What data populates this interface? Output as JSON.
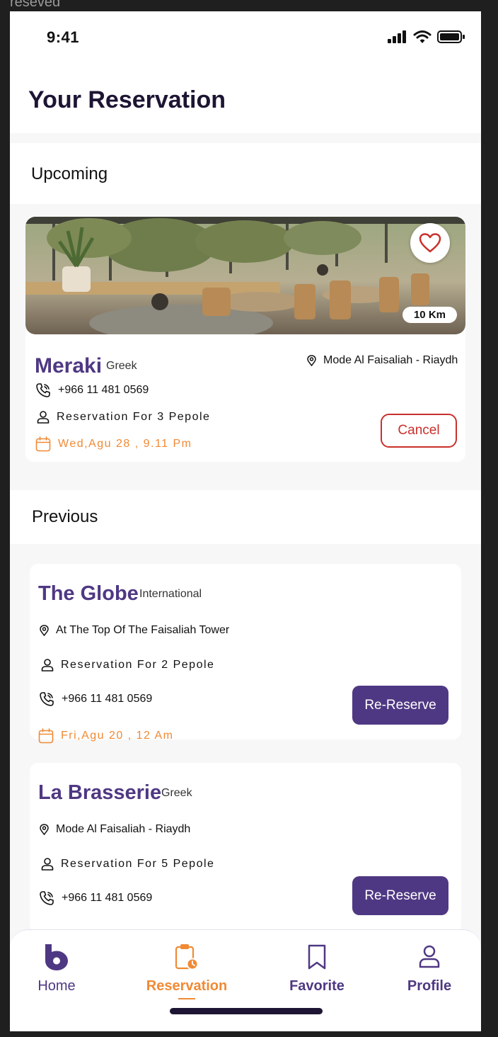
{
  "frame_label": "reseved",
  "status_bar": {
    "time": "9:41"
  },
  "header": {
    "title": "Your Reservation"
  },
  "upcoming": {
    "section_title": "Upcoming",
    "card": {
      "distance": "10 Km",
      "name": "Meraki",
      "cuisine": "Greek",
      "location": "Mode Al Faisaliah - Riaydh",
      "phone": "+966 11 481 0569",
      "guests": "Reservation For 3 Pepole",
      "datetime": "Wed,Agu 28 , 9.11 Pm",
      "cancel_label": "Cancel"
    }
  },
  "previous": {
    "section_title": "Previous",
    "cards": [
      {
        "name": "The Globe",
        "cuisine": "International",
        "location": "At The Top Of The Faisaliah Tower",
        "guests": "Reservation For 2 Pepole",
        "phone": "+966 11 481 0569",
        "datetime": "Fri,Agu 20 , 12 Am",
        "button_label": "Re-Reserve"
      },
      {
        "name": "La Brasserie",
        "cuisine": "Greek",
        "location": "Mode Al Faisaliah - Riaydh",
        "guests": "Reservation For 5 Pepole",
        "phone": "+966 11 481 0569",
        "button_label": "Re-Reserve"
      }
    ]
  },
  "bottom_nav": {
    "items": [
      {
        "label": "Home",
        "icon": "home-logo-icon",
        "active": false
      },
      {
        "label": "Reservation",
        "icon": "clipboard-clock-icon",
        "active": true
      },
      {
        "label": "Favorite",
        "icon": "bookmark-icon",
        "active": false
      },
      {
        "label": "Profile",
        "icon": "person-icon",
        "active": false
      }
    ]
  },
  "colors": {
    "brand_purple": "#4f3883",
    "accent_orange": "#f08a35",
    "cancel_red": "#c9302c",
    "title_dark": "#1e1534"
  }
}
